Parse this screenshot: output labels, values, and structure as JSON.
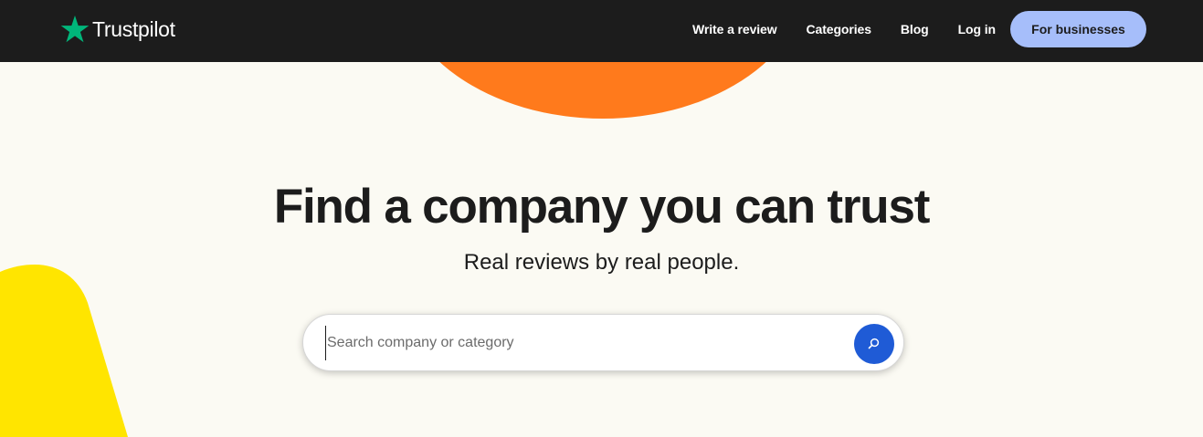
{
  "header": {
    "logo_text": "Trustpilot",
    "logo_icon": "star-icon",
    "nav": {
      "write_review": "Write a review",
      "categories": "Categories",
      "blog": "Blog",
      "login": "Log in",
      "for_businesses": "For businesses"
    }
  },
  "hero": {
    "title": "Find a company you can trust",
    "subtitle": "Real reviews by real people."
  },
  "search": {
    "placeholder": "Search company or category",
    "value": "",
    "button_icon": "search-icon"
  },
  "colors": {
    "topbar": "#1c1c1c",
    "brand_green": "#00b67a",
    "business_button": "#a6befa",
    "search_button": "#1f5bd6",
    "page_background": "#fbfaf3",
    "decor_orange": "#ff7a1c",
    "decor_yellow": "#ffe500"
  }
}
